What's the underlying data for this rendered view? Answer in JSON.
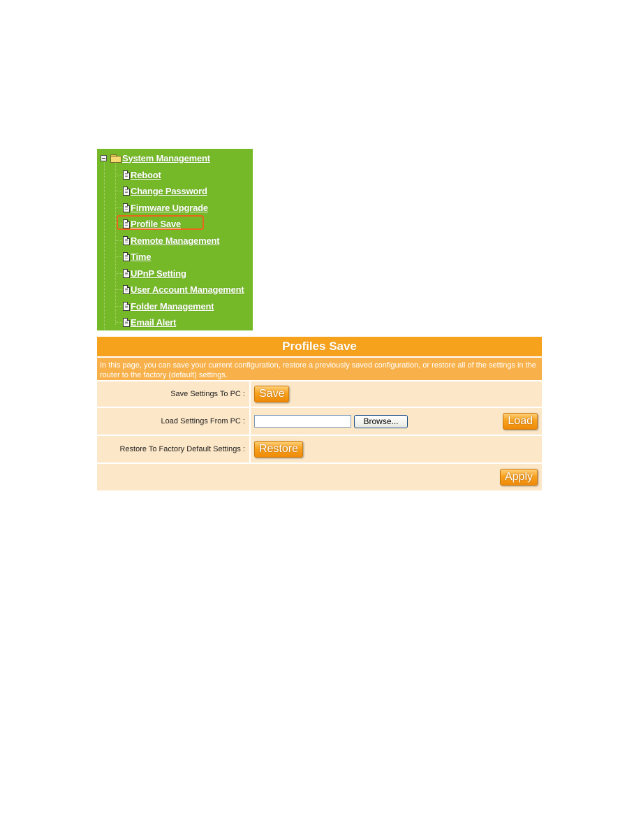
{
  "tree": {
    "root": {
      "label": "System Management",
      "icon": "folder-open-icon",
      "toggle": "minus-icon"
    },
    "items": [
      {
        "label": "Reboot",
        "icon": "document-icon"
      },
      {
        "label": "Change Password",
        "icon": "document-icon"
      },
      {
        "label": "Firmware Upgrade",
        "icon": "document-icon"
      },
      {
        "label": "Profile Save",
        "icon": "document-icon",
        "highlighted": true
      },
      {
        "label": "Remote Management",
        "icon": "document-icon"
      },
      {
        "label": "Time",
        "icon": "document-icon"
      },
      {
        "label": "UPnP Setting",
        "icon": "document-icon"
      },
      {
        "label": "User Account Management",
        "icon": "document-icon"
      },
      {
        "label": "Folder Management",
        "icon": "document-icon"
      },
      {
        "label": "Email Alert",
        "icon": "document-icon"
      }
    ],
    "colors": {
      "background": "#75b928",
      "highlight": "#e8661e"
    }
  },
  "panel": {
    "title": "Profiles Save",
    "description": "In this page, you can save your current configuration, restore a previously saved configuration, or restore all of the settings in the router to the factory (default) settings.",
    "rows": {
      "save": {
        "label": "Save Settings To PC :",
        "button": "Save"
      },
      "load": {
        "label": "Load Settings From PC :",
        "file_value": "",
        "browse": "Browse...",
        "button": "Load"
      },
      "restore": {
        "label": "Restore To Factory Default Settings :",
        "button": "Restore"
      },
      "apply": {
        "button": "Apply"
      }
    },
    "colors": {
      "title_bg": "#f6a21c",
      "desc_bg": "#f8b14a",
      "row_bg": "#fce7c8",
      "button": "#f8a21e"
    }
  }
}
